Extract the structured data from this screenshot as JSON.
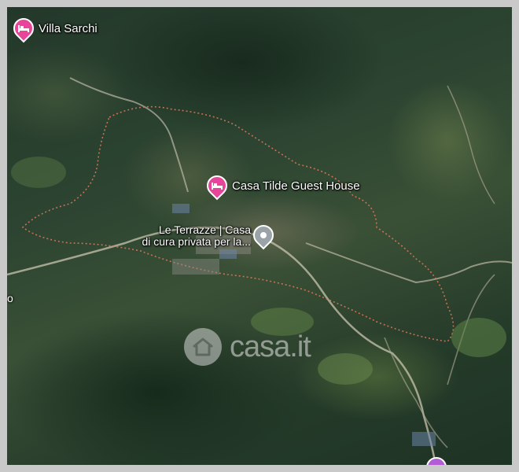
{
  "map": {
    "type": "satellite",
    "pois": [
      {
        "id": "villa-sarchi",
        "label": "Villa Sarchi",
        "category": "lodging",
        "icon": "bed-icon",
        "color": "#e8459a"
      },
      {
        "id": "casa-tilde",
        "label": "Casa Tilde Guest House",
        "category": "lodging",
        "icon": "bed-icon",
        "color": "#e8459a"
      }
    ],
    "place": {
      "line1": "Le Terrazze | Casa",
      "line2": "di cura privata per la...",
      "icon": "location-pin-icon"
    },
    "edge_label": "o",
    "watermark": {
      "text": "casa.it",
      "icon": "house-icon"
    },
    "bottom_marker_icon": "purple-marker-icon"
  }
}
